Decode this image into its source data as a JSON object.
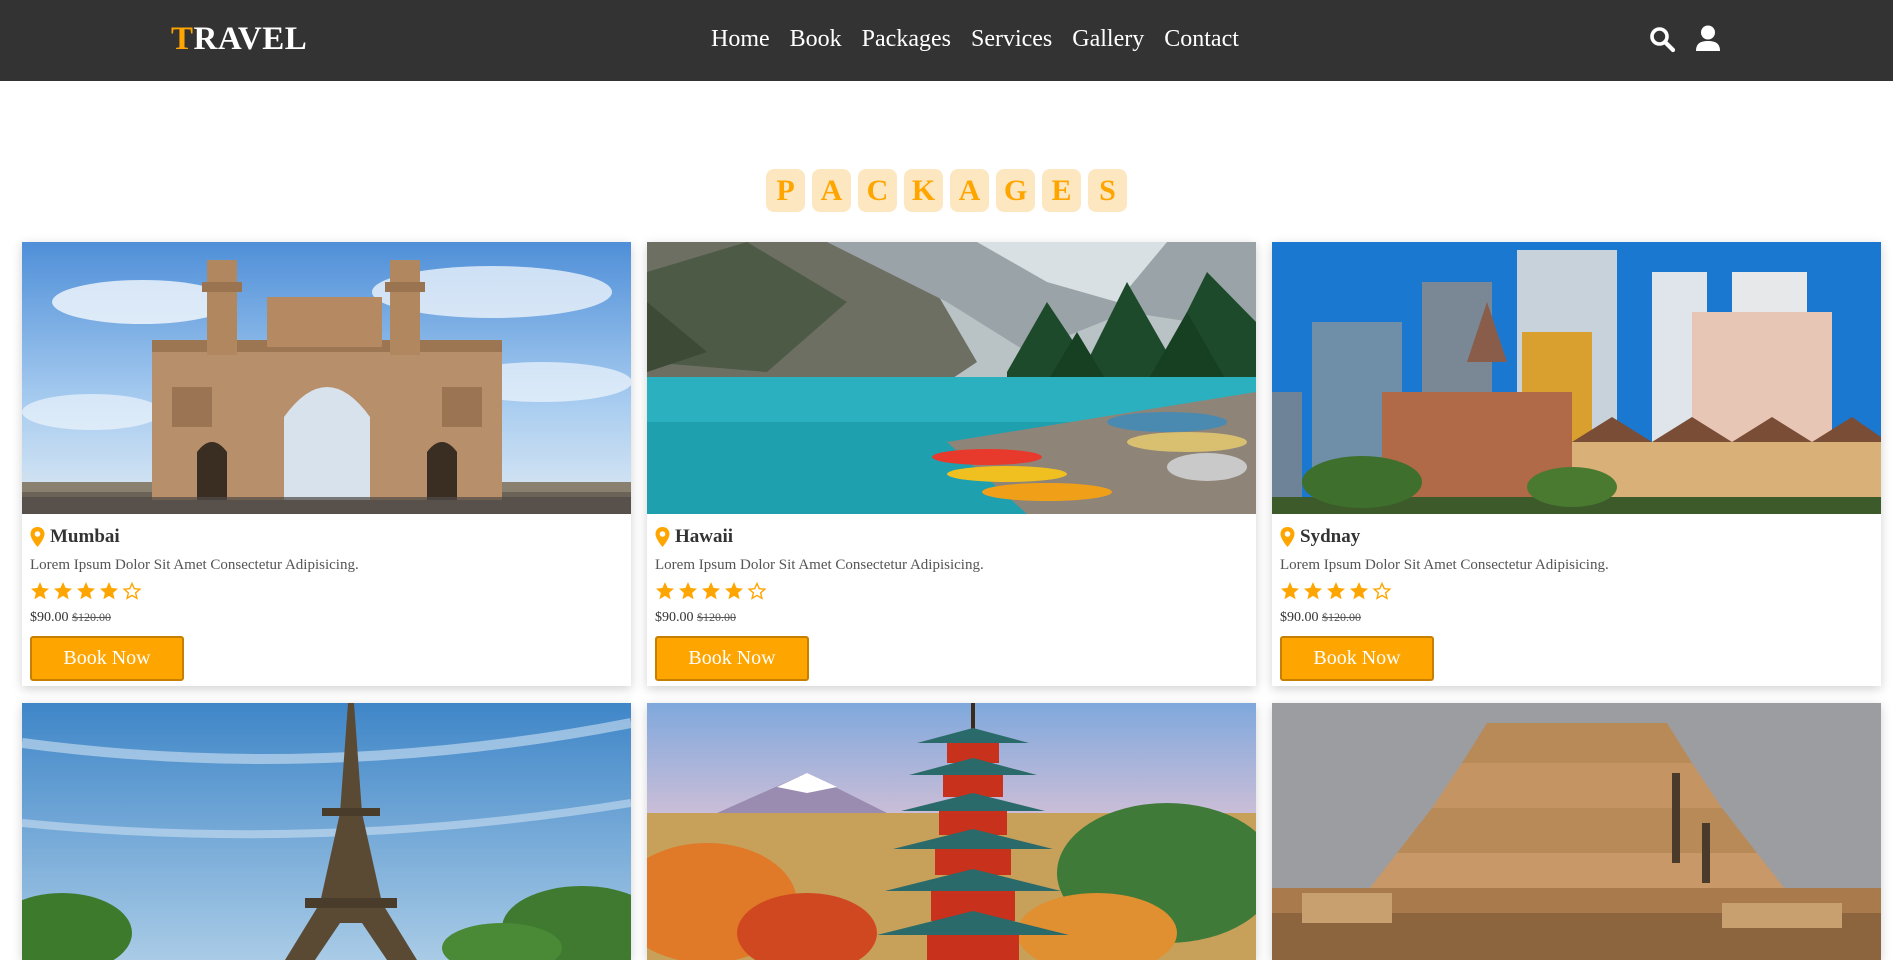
{
  "header": {
    "logo_first": "T",
    "logo_rest": "RAVEL",
    "nav": [
      "Home",
      "Book",
      "Packages",
      "Services",
      "Gallery",
      "Contact"
    ]
  },
  "heading_letters": [
    "P",
    "A",
    "C",
    "K",
    "A",
    "G",
    "E",
    "S"
  ],
  "colors": {
    "accent": "#ffa500",
    "header_bg": "#333333",
    "letter_bg": "#fde7c1"
  },
  "packages": [
    {
      "location": "Mumbai",
      "description": "Lorem Ipsum Dolor Sit Amet Consectetur Adipisicing.",
      "rating": 4,
      "max_rating": 5,
      "price": "$90.00",
      "old_price": "$120.00",
      "button": "Book Now",
      "image": "gateway-of-india-photo"
    },
    {
      "location": "Hawaii",
      "description": "Lorem Ipsum Dolor Sit Amet Consectetur Adipisicing.",
      "rating": 4,
      "max_rating": 5,
      "price": "$90.00",
      "old_price": "$120.00",
      "button": "Book Now",
      "image": "mountain-lake-canoes-photo"
    },
    {
      "location": "Sydnay",
      "description": "Lorem Ipsum Dolor Sit Amet Consectetur Adipisicing.",
      "rating": 4,
      "max_rating": 5,
      "price": "$90.00",
      "old_price": "$120.00",
      "button": "Book Now",
      "image": "city-skyline-photo"
    },
    {
      "image": "eiffel-tower-photo"
    },
    {
      "image": "pagoda-mount-fuji-photo"
    },
    {
      "image": "step-pyramid-photo"
    }
  ]
}
